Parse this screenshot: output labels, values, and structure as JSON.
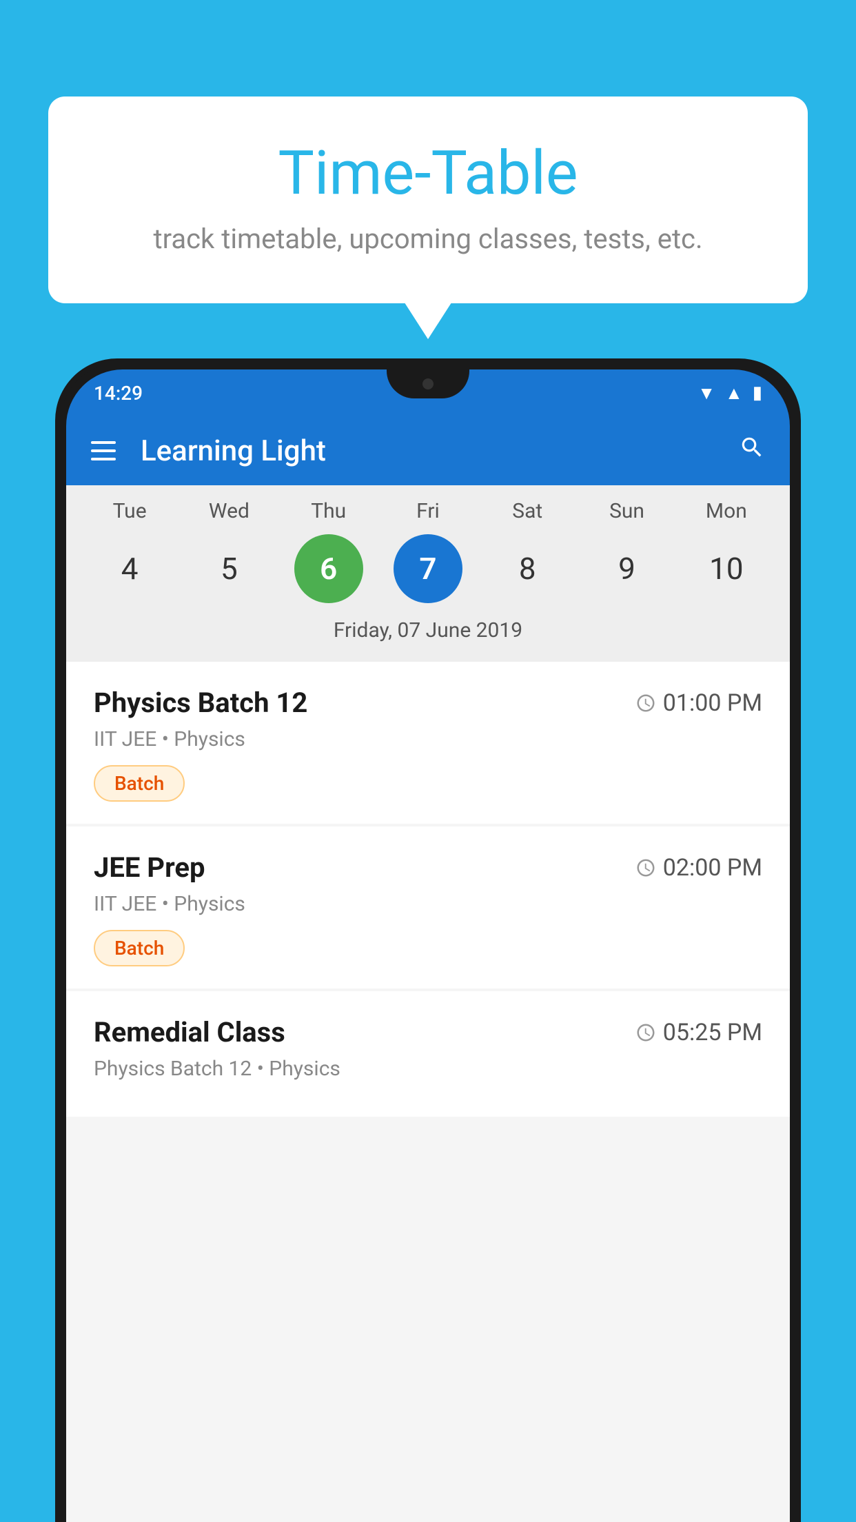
{
  "background_color": "#29b6e8",
  "bubble": {
    "title": "Time-Table",
    "subtitle": "track timetable, upcoming classes, tests, etc."
  },
  "phone": {
    "status_bar": {
      "time": "14:29"
    },
    "app_bar": {
      "title": "Learning Light"
    },
    "calendar": {
      "days": [
        {
          "name": "Tue",
          "number": "4",
          "state": "normal"
        },
        {
          "name": "Wed",
          "number": "5",
          "state": "normal"
        },
        {
          "name": "Thu",
          "number": "6",
          "state": "today"
        },
        {
          "name": "Fri",
          "number": "7",
          "state": "selected"
        },
        {
          "name": "Sat",
          "number": "8",
          "state": "normal"
        },
        {
          "name": "Sun",
          "number": "9",
          "state": "normal"
        },
        {
          "name": "Mon",
          "number": "10",
          "state": "normal"
        }
      ],
      "selected_date_label": "Friday, 07 June 2019"
    },
    "schedule": [
      {
        "title": "Physics Batch 12",
        "time": "01:00 PM",
        "subtitle": "IIT JEE • Physics",
        "badge": "Batch"
      },
      {
        "title": "JEE Prep",
        "time": "02:00 PM",
        "subtitle": "IIT JEE • Physics",
        "badge": "Batch"
      },
      {
        "title": "Remedial Class",
        "time": "05:25 PM",
        "subtitle": "Physics Batch 12 • Physics",
        "badge": null
      }
    ]
  }
}
